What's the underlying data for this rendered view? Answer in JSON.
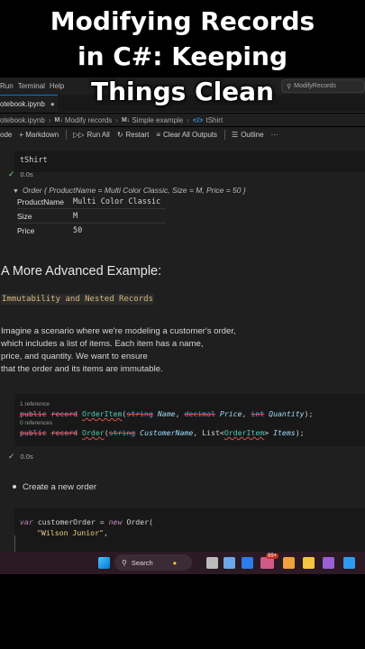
{
  "overlay": {
    "title_lines": [
      "Modifying Records",
      "in C#: Keeping",
      "Things Clean"
    ]
  },
  "menu": {
    "items": [
      "Run",
      "Terminal",
      "Help"
    ],
    "search_text": "ModifyRecords"
  },
  "tab": {
    "label": "otebook.ipynb",
    "close": "●"
  },
  "breadcrumb": {
    "file": "otebook.ipynb",
    "nb_icon": "M↓",
    "items": [
      "Modify records",
      "Simple example",
      "tShirt"
    ]
  },
  "toolbar": {
    "code": "ode",
    "markdown": "+ Markdown",
    "run_all": "Run All",
    "restart": "Restart",
    "clear": "Clear All Outputs",
    "outline": "Outline",
    "more": "···"
  },
  "cell1": {
    "code": "tShirt",
    "time": "0.0s",
    "check": "✓"
  },
  "output1": {
    "header": "Order { ProductName = Multi Color Classic, Size = M, Price = 50 }",
    "rows": [
      {
        "key": "ProductName",
        "value": "Multi Color Classic"
      },
      {
        "key": "Size",
        "value": "M"
      },
      {
        "key": "Price",
        "value": "50"
      }
    ]
  },
  "markdown": {
    "heading": "A More Advanced Example:",
    "code_span": "Immutability and Nested Records",
    "para": [
      "Imagine a scenario where we're modeling a customer's order,",
      "which includes a list of items. Each item has a name,",
      "price, and quantity. We want to ensure",
      "that the order and its items are immutable."
    ]
  },
  "cell3": {
    "lens1": "1 reference",
    "lens2": "0 references",
    "l1": {
      "kw1": "public",
      "kw2": "record",
      "name": "OrderItem",
      "p": "(",
      "t1": "string",
      "n1": "Name",
      "c1": ", ",
      "t2": "decimal",
      "n2": "Price",
      "c2": ", ",
      "t3": "int",
      "n3": "Quantity",
      "end": ");"
    },
    "l2": {
      "kw1": "public",
      "kw2": "record",
      "name": "Order",
      "p": "(",
      "t1": "string",
      "n1": "CustomerName",
      "c1": ", ",
      "t2": "List",
      "lt": "<",
      "t2g": "OrderItem",
      "gt": ">",
      "n2": "Items",
      "end": ");"
    },
    "time": "0.0s",
    "check": "✓"
  },
  "bullet": "Create a new order",
  "cell4": {
    "l1": {
      "kw": "var",
      "v": "customerOrder",
      "eq": " = ",
      "kw2": "new",
      "t": "Order",
      "p": "("
    },
    "l2": {
      "s": "\"Wilson Junior\"",
      "c": ","
    }
  },
  "taskbar": {
    "search": "Search",
    "badge": "99+"
  }
}
